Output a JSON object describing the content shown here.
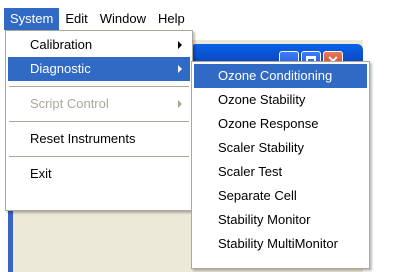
{
  "colors": {
    "menu_highlight": "#316ac5",
    "disabled_text": "#aca899",
    "window_titlebar": "#0b49c6"
  },
  "menubar": {
    "items": [
      "System",
      "Edit",
      "Window",
      "Help"
    ]
  },
  "system_menu": {
    "items": [
      {
        "label": "Calibration",
        "submenu": true
      },
      {
        "label": "Diagnostic",
        "submenu": true,
        "highlighted": true
      },
      {
        "label": "Script Control",
        "submenu": true,
        "disabled": true
      },
      {
        "label": "Reset Instruments"
      },
      {
        "label": "Exit"
      }
    ]
  },
  "diagnostic_menu": {
    "items": [
      {
        "label": "Ozone Conditioning",
        "highlighted": true
      },
      {
        "label": "Ozone Stability"
      },
      {
        "label": "Ozone Response"
      },
      {
        "label": "Scaler Stability"
      },
      {
        "label": "Scaler Test"
      },
      {
        "label": "Separate Cell"
      },
      {
        "label": "Stability Monitor"
      },
      {
        "label": "Stability MultiMonitor"
      }
    ]
  },
  "window": {
    "buttons": [
      "minimize-icon",
      "maximize-icon",
      "close-icon"
    ],
    "close_glyph": "✕"
  }
}
